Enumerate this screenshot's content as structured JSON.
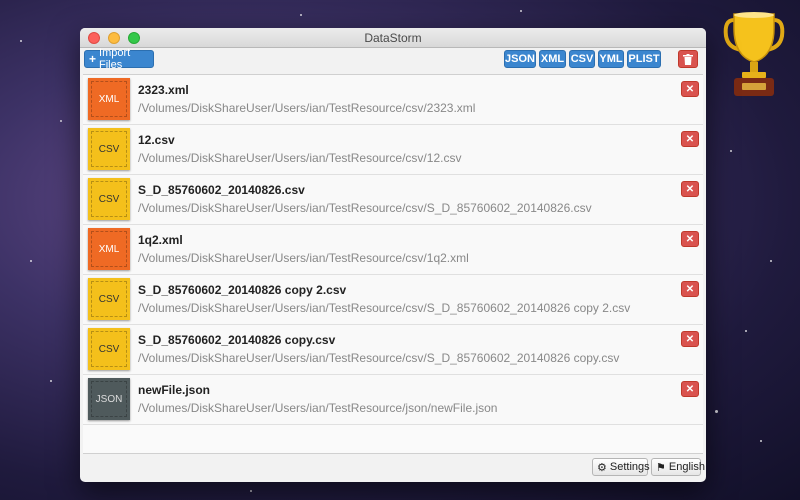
{
  "window": {
    "title": "DataStorm"
  },
  "toolbar": {
    "import_label": "Import Files",
    "formats": [
      "JSON",
      "XML",
      "CSV",
      "YML",
      "PLIST"
    ]
  },
  "files": [
    {
      "type": "XML",
      "name": "2323.xml",
      "path": "/Volumes/DiskShareUser/Users/ian/TestResource/csv/2323.xml"
    },
    {
      "type": "CSV",
      "name": "12.csv",
      "path": "/Volumes/DiskShareUser/Users/ian/TestResource/csv/12.csv"
    },
    {
      "type": "CSV",
      "name": "S_D_85760602_20140826.csv",
      "path": "/Volumes/DiskShareUser/Users/ian/TestResource/csv/S_D_85760602_20140826.csv"
    },
    {
      "type": "XML",
      "name": "1q2.xml",
      "path": "/Volumes/DiskShareUser/Users/ian/TestResource/csv/1q2.xml"
    },
    {
      "type": "CSV",
      "name": "S_D_85760602_20140826 copy 2.csv",
      "path": "/Volumes/DiskShareUser/Users/ian/TestResource/csv/S_D_85760602_20140826 copy 2.csv"
    },
    {
      "type": "CSV",
      "name": "S_D_85760602_20140826 copy.csv",
      "path": "/Volumes/DiskShareUser/Users/ian/TestResource/csv/S_D_85760602_20140826 copy.csv"
    },
    {
      "type": "JSON",
      "name": "newFile.json",
      "path": "/Volumes/DiskShareUser/Users/ian/TestResource/json/newFile.json"
    }
  ],
  "footer": {
    "settings_label": "Settings",
    "language_label": "English"
  },
  "colors": {
    "xml": "#ef6a24",
    "csv": "#f4c01b",
    "json": "#4f5a5c",
    "accent": "#3b86cf",
    "danger": "#d9534f"
  }
}
